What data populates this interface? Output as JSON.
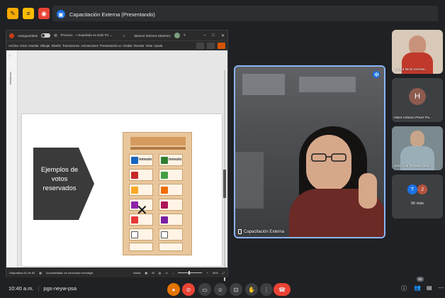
{
  "meet": {
    "presentation_title": "Capacitación Externa (Presentando)",
    "meeting_time": "10:40 a.m.",
    "meeting_code": "pgs-neyw-psa",
    "participant_count_badge": "62",
    "more_participants": "56 más"
  },
  "ppt": {
    "autosave_label": "Autoguardado",
    "file_label": "Proceso... • Guardado en Este PC ⌄",
    "user_name": "Marisol Jiménez Martínez",
    "menu": [
      "Archivo",
      "Inicio",
      "Insertar",
      "Dibujar",
      "Diseño",
      "Transiciones",
      "Animaciones",
      "Presentación co",
      "Grabar",
      "Revisar",
      "Vista",
      "Ayuda"
    ],
    "thumb_label": "Miniaturas",
    "slide_text": [
      "Ejemplos de",
      "votos",
      "reservados"
    ],
    "ballot_party_text": [
      "inmuto",
      "inmuto"
    ],
    "status_slide": "Diapositiva 51 de 83",
    "status_accessibility": "Accesibilidad: es necesario investigar",
    "status_notes": "Notas",
    "zoom": "40%"
  },
  "main_tile": {
    "name": "Capacitación Externa"
  },
  "side_tiles": [
    {
      "name": "Aurora Nicte Hernán..."
    },
    {
      "name": "Hiber Antonio Pérez Pa...",
      "initial": "H"
    },
    {
      "name": "José Luis Rosales Med..."
    }
  ],
  "more_tile": {
    "initials": [
      "T",
      "J"
    ]
  },
  "colors": {
    "accent": "#8ab4f8",
    "hangup": "#ea4335",
    "slide_arrow": "#3a3a3a",
    "avatar_h": "#8d5a4f",
    "avatar_t": "#1a73e8",
    "avatar_j": "#b5533f"
  }
}
